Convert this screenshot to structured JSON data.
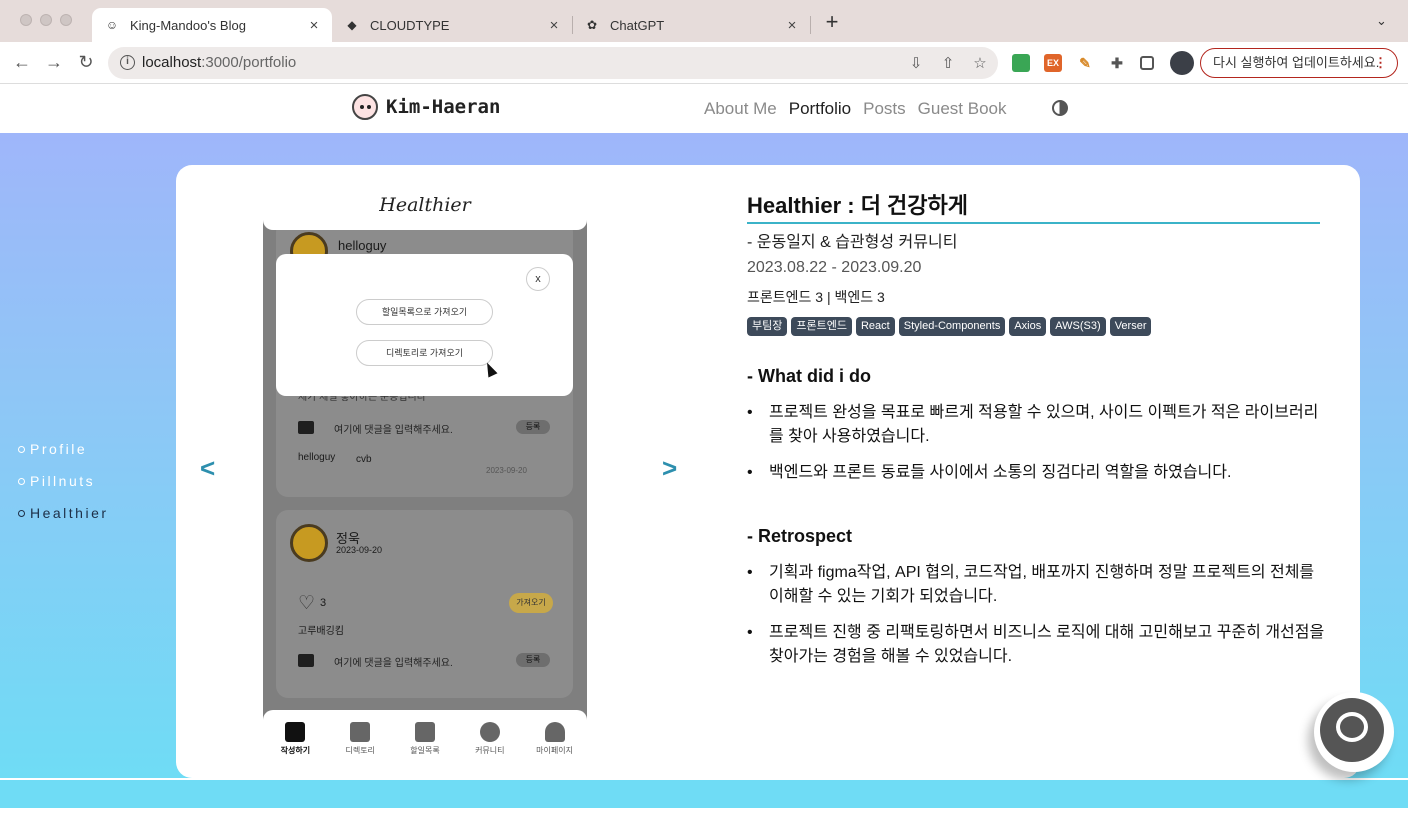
{
  "browser": {
    "tabs": [
      {
        "title": "King-Mandoo's Blog",
        "icon": "blog-favicon-icon",
        "active": true
      },
      {
        "title": "CLOUDTYPE",
        "icon": "cloudtype-icon",
        "active": false
      },
      {
        "title": "ChatGPT",
        "icon": "chatgpt-icon",
        "active": false
      }
    ],
    "tab_close": "×",
    "new_tab": "+",
    "url_host": "localhost",
    "url_path": ":3000/portfolio",
    "update_label": "다시 실행하여 업데이트하세요.",
    "update_menu": "⋮",
    "ext_labels": [
      "",
      "EX",
      ""
    ]
  },
  "site": {
    "logo": "Kim-Haeran",
    "nav": [
      "About Me",
      "Portfolio",
      "Posts",
      "Guest Book"
    ],
    "nav_current": "Portfolio"
  },
  "sidenav": [
    {
      "label": "Profile"
    },
    {
      "label": "Pillnuts"
    },
    {
      "label": "Healthier"
    }
  ],
  "carousel": {
    "prev": "<",
    "next": ">"
  },
  "phone": {
    "app_title": "Healthier",
    "post1_user": "helloguy",
    "comment_placeholder": "여기에 댓글을 입력해주세요.",
    "comment_btn": "등록",
    "comment_user": "helloguy",
    "comment_text": "cvb",
    "comment_date": "2023-09-20",
    "post1_partial": "제가 제일 좋아하는 운동입니다",
    "post2_user": "정욱",
    "post2_date": "2023-09-20",
    "likes": "3",
    "fetch_btn": "가져오기",
    "post2_text": "고루배깅킴",
    "modal": {
      "close": "x",
      "btn1": "할일목록으로 가져오기",
      "btn2": "디렉토리로 가져오기"
    },
    "tabbar": [
      "작성하기",
      "디렉토리",
      "할일목록",
      "커뮤니티",
      "마이페이지"
    ]
  },
  "project": {
    "title": "Healthier : 더 건강하게",
    "subtitle": "- 운동일지 & 습관형성 커뮤니티",
    "period": "2023.08.22 - 2023.09.20",
    "team": "프론트엔드 3 | 백엔드 3",
    "tags": [
      "부팀장",
      "프론트엔드",
      "React",
      "Styled-Components",
      "Axios",
      "AWS(S3)",
      "Verser"
    ],
    "what_title": "- What did i do",
    "what_items": [
      "프로젝트 완성을 목표로 빠르게 적용할 수 있으며, 사이드 이펙트가 적은 라이브러리를 찾아 사용하였습니다.",
      "백엔드와 프론트 동료들 사이에서 소통의 징검다리 역할을 하였습니다."
    ],
    "retro_title": "- Retrospect",
    "retro_items": [
      "기획과 figma작업, API 협의, 코드작업, 배포까지 진행하며 정말 프로젝트의 전체를 이해할 수 있는 기회가 되었습니다.",
      "프로젝트 진행 중 리팩토링하면서 비즈니스 로직에 대해 고민해보고 꾸준히 개선점을 찾아가는 경험을 해볼 수 있었습니다."
    ]
  },
  "colors": {
    "accent": "#2d8fae",
    "tag_bg": "#3d4a5a",
    "update_border": "#b3261e"
  }
}
